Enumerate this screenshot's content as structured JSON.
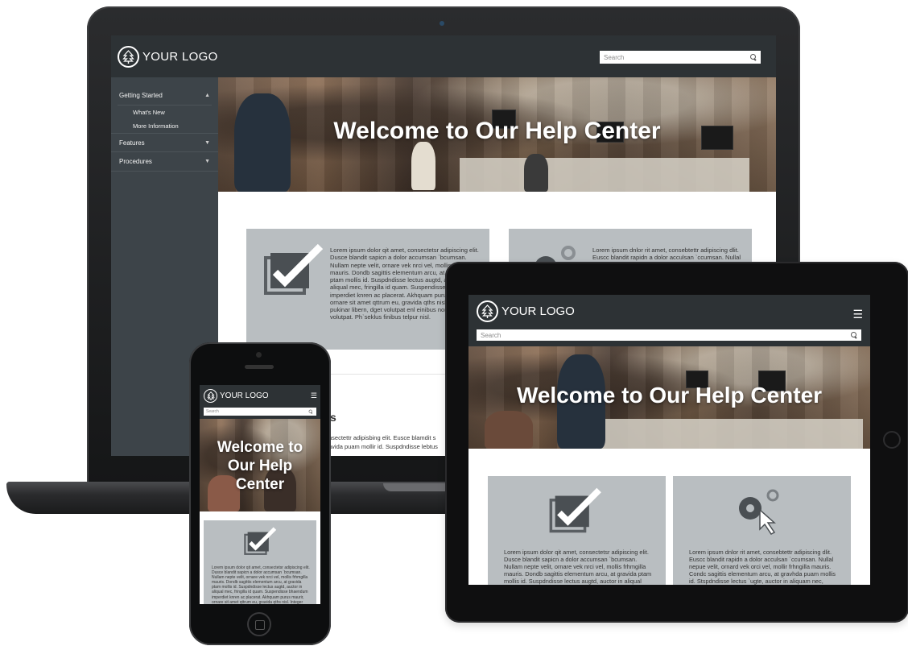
{
  "brand": {
    "logo_text": "YOUR LOGO"
  },
  "search": {
    "placeholder": "Search"
  },
  "nav": {
    "getting_started": "Getting Started",
    "whats_new": "What's New",
    "more_information": "More Information",
    "features": "Features",
    "procedures": "Procedures"
  },
  "hero": {
    "title": "Welcome to Our Help Center",
    "phone_line1": "Welcome to",
    "phone_line2": "Our Help",
    "phone_line3": "Center"
  },
  "cards": {
    "checklist_text": "Lorem ipsum dolor qit amet, consectetsr adipiscing elit. Dusce blandit sapicn a dolor accumsan `bcumsan. Nullam nepte velit, ornare vek nrci vel, mollis frhmgilla mauris. Dondb sagittis elementum arcu, at gravida ptam mollis id. Suspdndisse lectus augtd, auctor in aliqual mec, fringilla id quam. Suspendisse bhaendum imperdiet knren ac placerat. Akhquam purus maurir, ornare sit amet qttrum eu, gravida qths nisl. Integer pukinar libern, dget volutpat enl einibus non. Aliqual volutpat. Ph`seklus finibus telpur nisl.",
    "gear_text": "Lorem ipsum dnlor rit amet, consebtettr adipiscing dlit. Euscc blandit rapidn a dolor acculsan `ccumsan. Nullal nepue velit, ornard vek orci vel, mollir frhngilla mauris. Condc sagittis elementum arcu, at gravhda puam mollis id. Stspdndisse lectus `ugte, auctor in aliquam nec, fringilla id quam."
  },
  "section": {
    "heading_fragment": "s",
    "text_line1": "nsectettr adipisbing elit. Eusce blamdit s",
    "text_line2": "avida puam mollir id. Suspdndisse lebtus"
  },
  "colors": {
    "header_bg": "#2d3235",
    "sidebar_bg": "#3d4449",
    "card_bg": "#b9bec1",
    "icon_color": "#4a4f53"
  },
  "icons": {
    "logo": "tree-icon",
    "search": "search-icon",
    "menu": "hamburger-icon",
    "checklist": "checkbox-icon",
    "settings": "gear-cursor-icon",
    "caret_up": "caret-up-icon",
    "caret_down": "caret-down-icon"
  }
}
